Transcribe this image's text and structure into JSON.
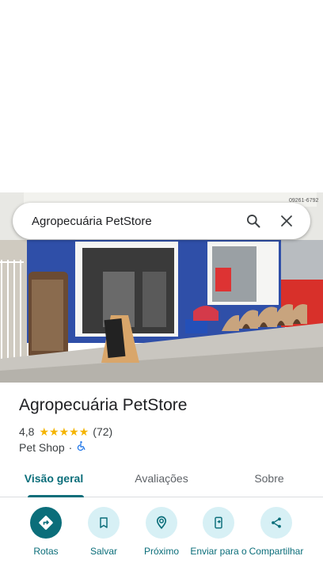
{
  "search": {
    "query": "Agropecuária PetStore"
  },
  "photo": {
    "alt_description": ""
  },
  "place": {
    "name": "Agropecuária PetStore",
    "rating": "4,8",
    "reviews": "(72)",
    "category": "Pet Shop",
    "separator": "·"
  },
  "tabs": [
    {
      "label": "Visão geral",
      "active": true
    },
    {
      "label": "Avaliações",
      "active": false
    },
    {
      "label": "Sobre",
      "active": false
    }
  ],
  "actions": [
    {
      "label": "Rotas",
      "icon": "directions-icon"
    },
    {
      "label": "Salvar",
      "icon": "bookmark-icon"
    },
    {
      "label": "Próximo",
      "icon": "nearby-icon"
    },
    {
      "label": "Enviar para o",
      "icon": "send-to-phone-icon"
    },
    {
      "label": "Compartilhar",
      "icon": "share-icon"
    }
  ],
  "colors": {
    "accent": "#0b6e7a",
    "accent_light": "#d7f0f5",
    "star": "#f4b400"
  }
}
